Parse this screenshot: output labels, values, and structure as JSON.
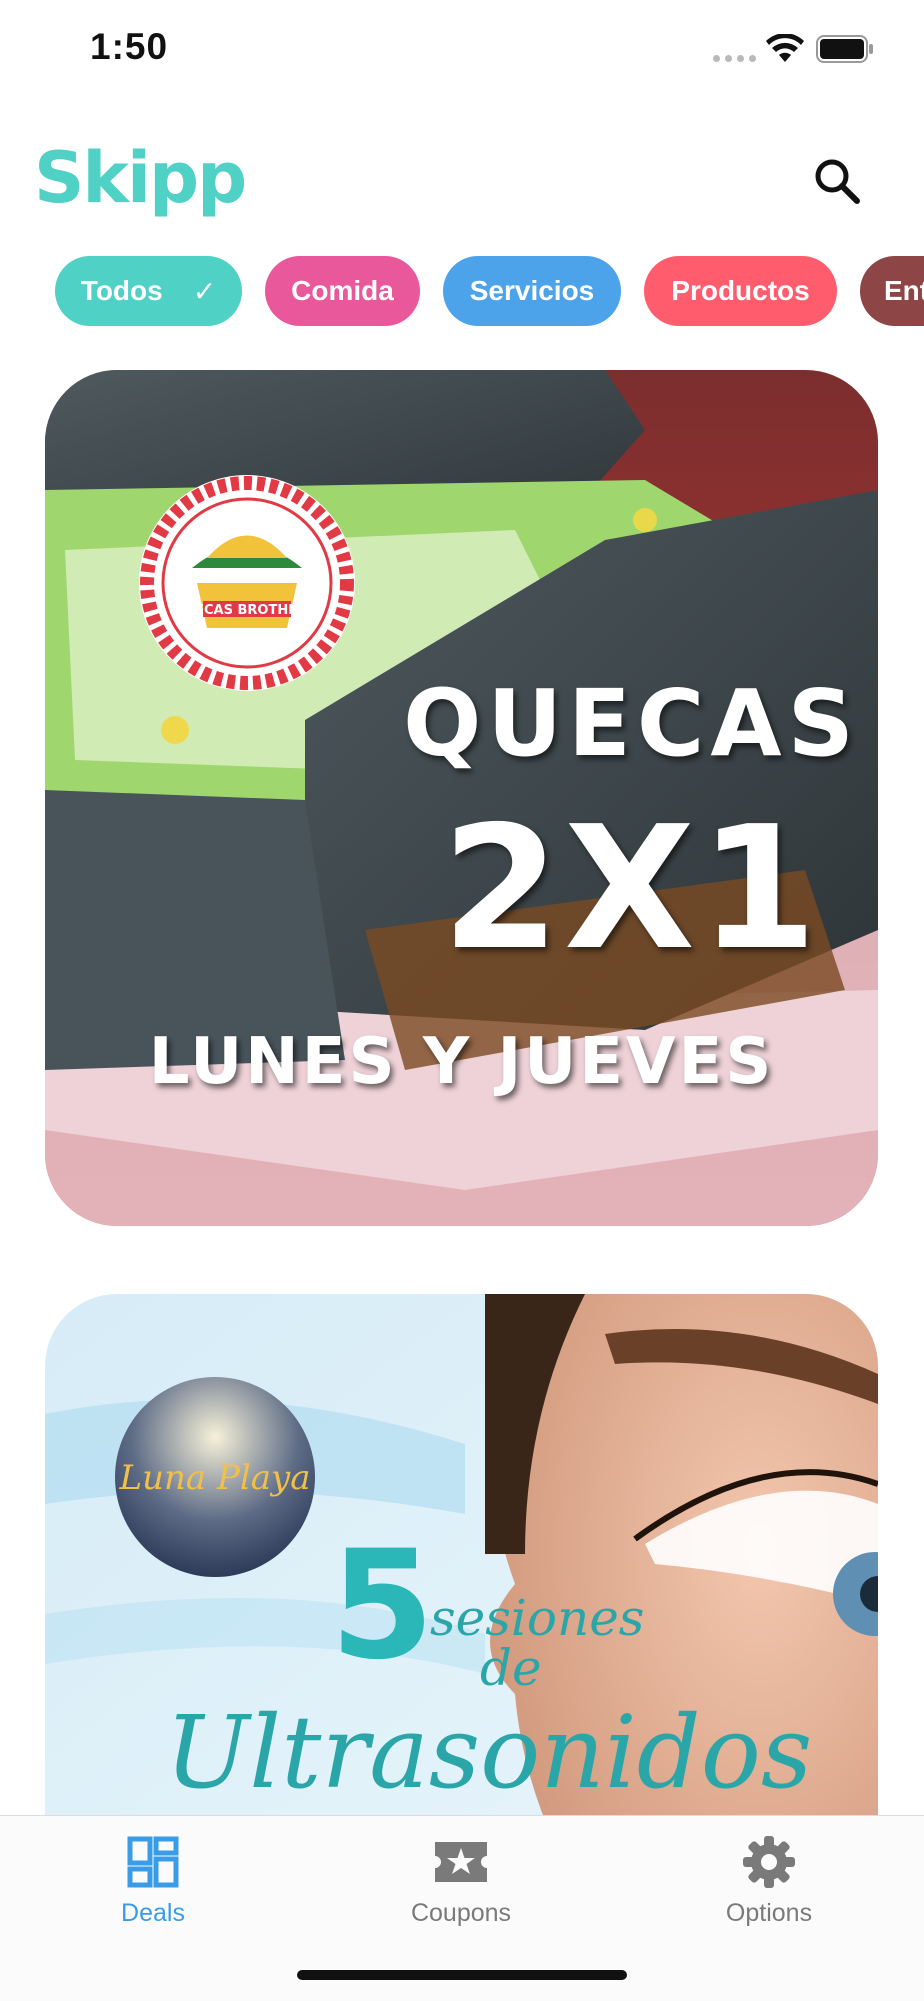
{
  "status_bar": {
    "time": "1:50"
  },
  "app": {
    "name": "Skipp"
  },
  "chips": [
    {
      "label": "Todos",
      "color": "#4fd1c5",
      "selected": true
    },
    {
      "label": "Comida",
      "color": "#e8589b",
      "selected": false
    },
    {
      "label": "Servicios",
      "color": "#4da3ea",
      "selected": false
    },
    {
      "label": "Productos",
      "color": "#ff5d6e",
      "selected": false
    },
    {
      "label": "Ent",
      "color": "#8d4545",
      "selected": false
    }
  ],
  "deals": [
    {
      "logo_text": "QUECAS BROTHER'S",
      "headline": "QUECAS",
      "offer": "2X1",
      "days": "LUNES Y JUEVES"
    },
    {
      "logo_text": "Luna Playa",
      "count": "5",
      "line1": "sesiones",
      "line2": "de",
      "title": "Ultrasonidos"
    }
  ],
  "tabs": [
    {
      "label": "Deals",
      "icon": "grid-icon",
      "active": true
    },
    {
      "label": "Coupons",
      "icon": "ticket-star-icon",
      "active": false
    },
    {
      "label": "Options",
      "icon": "gear-icon",
      "active": false
    }
  ],
  "colors": {
    "brand": "#4fd1c5",
    "active_tab": "#3a9be6",
    "inactive_tab": "#7a7a7a"
  }
}
